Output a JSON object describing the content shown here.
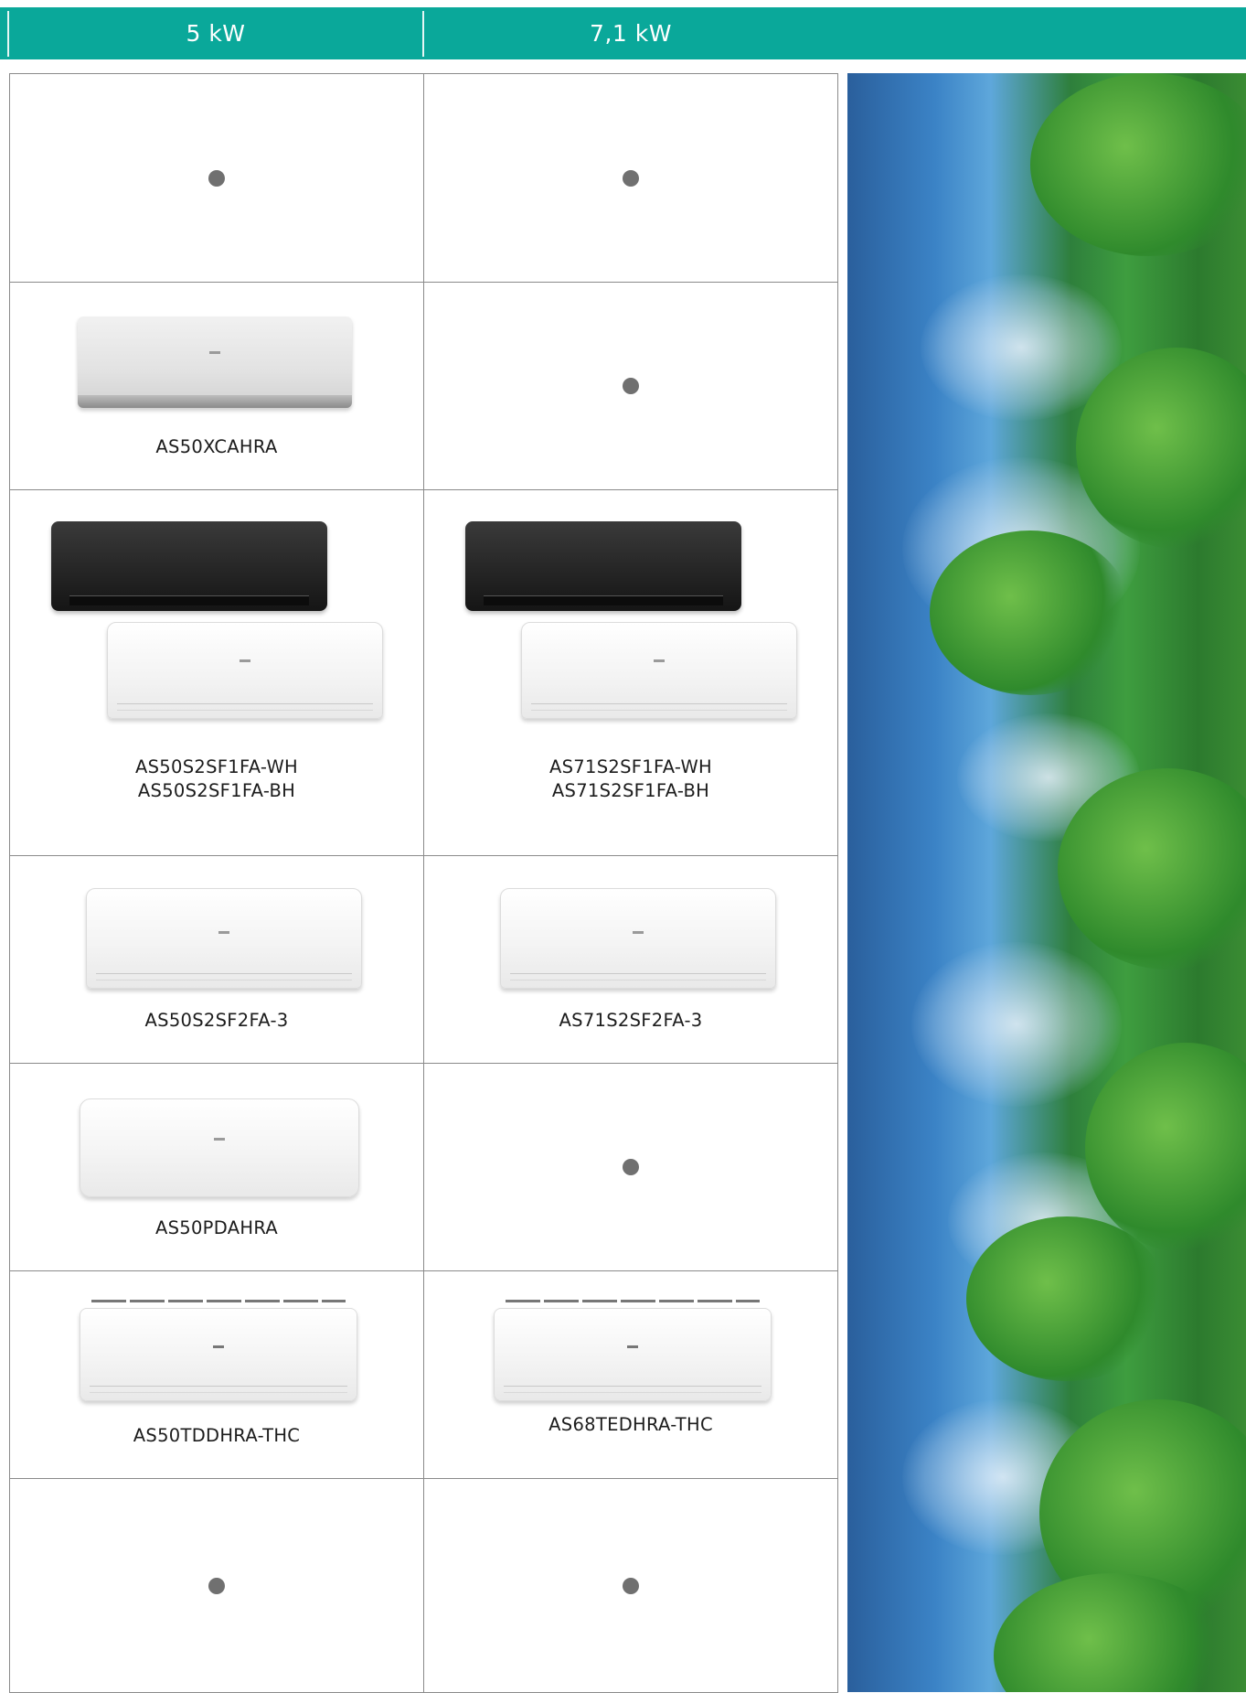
{
  "table": {
    "headers": [
      "5 kW",
      "7,1 kW"
    ],
    "rows": [
      {
        "c1": {
          "dot": true
        },
        "c2": {
          "dot": true
        }
      },
      {
        "c1": {
          "label": "AS50XCAHRA"
        },
        "c2": {
          "dot": true
        }
      },
      {
        "c1": {
          "label1": "AS50S2SF1FA-WH",
          "label2": "AS50S2SF1FA-BH"
        },
        "c2": {
          "label1": "AS71S2SF1FA-WH",
          "label2": "AS71S2SF1FA-BH"
        }
      },
      {
        "c1": {
          "label": "AS50S2SF2FA-3"
        },
        "c2": {
          "label": "AS71S2SF2FA-3"
        }
      },
      {
        "c1": {
          "label": "AS50PDAHRA"
        },
        "c2": {
          "dot": true
        }
      },
      {
        "c1": {
          "label": "AS50TDDHRA-THC"
        },
        "c2": {
          "label": "AS68TEDHRA-THC"
        }
      },
      {
        "c1": {
          "dot": true
        },
        "c2": {
          "dot": true
        }
      }
    ]
  },
  "colors": {
    "header": "#0aa89a",
    "dot": "#707070",
    "grid": "#8a8a8a"
  }
}
